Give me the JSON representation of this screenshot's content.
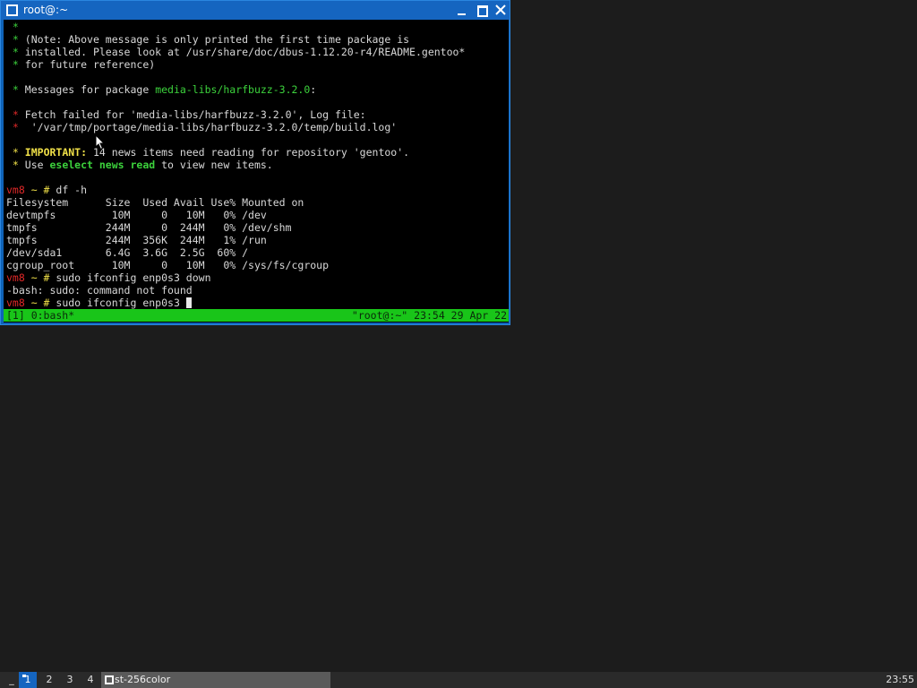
{
  "window": {
    "title": "root@:~",
    "icon": "terminal-window-icon",
    "buttons": {
      "minimize": "minimize-icon",
      "maximize": "maximize-icon",
      "close": "close-icon"
    }
  },
  "terminal": {
    "lines": [
      [
        {
          "t": " *",
          "c": "g"
        }
      ],
      [
        {
          "t": " *",
          "c": "g"
        },
        {
          "t": " (Note: Above message is only printed the first time package is"
        }
      ],
      [
        {
          "t": " *",
          "c": "g"
        },
        {
          "t": " installed. Please look at /usr/share/doc/dbus-1.12.20-r4/README.gentoo*"
        }
      ],
      [
        {
          "t": " *",
          "c": "g"
        },
        {
          "t": " for future reference)"
        }
      ],
      [
        {
          "t": ""
        }
      ],
      [
        {
          "t": " *",
          "c": "g"
        },
        {
          "t": " Messages for package "
        },
        {
          "t": "media-libs/harfbuzz-3.2.0",
          "c": "g"
        },
        {
          "t": ":"
        }
      ],
      [
        {
          "t": ""
        }
      ],
      [
        {
          "t": " *",
          "c": "r"
        },
        {
          "t": " Fetch failed for 'media-libs/harfbuzz-3.2.0', Log file:"
        }
      ],
      [
        {
          "t": " *",
          "c": "r"
        },
        {
          "t": "  '/var/tmp/portage/media-libs/harfbuzz-3.2.0/temp/build.log'"
        }
      ],
      [
        {
          "t": ""
        }
      ],
      [
        {
          "t": " *",
          "c": "y"
        },
        {
          "t": " "
        },
        {
          "t": "IMPORTANT:",
          "c": "yb"
        },
        {
          "t": " 14 news items need reading for repository 'gentoo'."
        }
      ],
      [
        {
          "t": " *",
          "c": "y"
        },
        {
          "t": " Use "
        },
        {
          "t": "eselect news read",
          "c": "gb"
        },
        {
          "t": " to view new items."
        }
      ],
      [
        {
          "t": ""
        }
      ],
      [
        {
          "t": "vm8",
          "c": "r"
        },
        {
          "t": " ~ #",
          "c": "y"
        },
        {
          "t": " df -h"
        }
      ],
      [
        {
          "t": "Filesystem      Size  Used Avail Use% Mounted on"
        }
      ],
      [
        {
          "t": "devtmpfs         10M     0   10M   0% /dev"
        }
      ],
      [
        {
          "t": "tmpfs           244M     0  244M   0% /dev/shm"
        }
      ],
      [
        {
          "t": "tmpfs           244M  356K  244M   1% /run"
        }
      ],
      [
        {
          "t": "/dev/sda1       6.4G  3.6G  2.5G  60% /"
        }
      ],
      [
        {
          "t": "cgroup_root      10M     0   10M   0% /sys/fs/cgroup"
        }
      ],
      [
        {
          "t": "vm8",
          "c": "r"
        },
        {
          "t": " ~ #",
          "c": "y"
        },
        {
          "t": " sudo ifconfig enp0s3 down"
        }
      ],
      [
        {
          "t": "-bash: sudo: command not found"
        }
      ],
      [
        {
          "t": "vm8",
          "c": "r"
        },
        {
          "t": " ~ #",
          "c": "y"
        },
        {
          "t": " sudo ifconfig enp0s3 "
        },
        {
          "cursor": true
        }
      ]
    ],
    "status_left": "[1] 0:bash*",
    "status_right": "\"root@:~\" 23:54 29 Apr 22"
  },
  "taskbar": {
    "menu_label": "_",
    "workspaces": [
      "1",
      "2",
      "3",
      "4"
    ],
    "active_workspace": "1",
    "task_icon": "window-icon",
    "task_label": "st-256color",
    "clock": "23:55"
  },
  "colors": {
    "titlebar": "#1565c0",
    "terminal_bg": "#000000",
    "status_bar": "#19c519",
    "prompt_host": "#e02828",
    "prompt_path": "#f0e048",
    "green": "#3cd23c"
  }
}
